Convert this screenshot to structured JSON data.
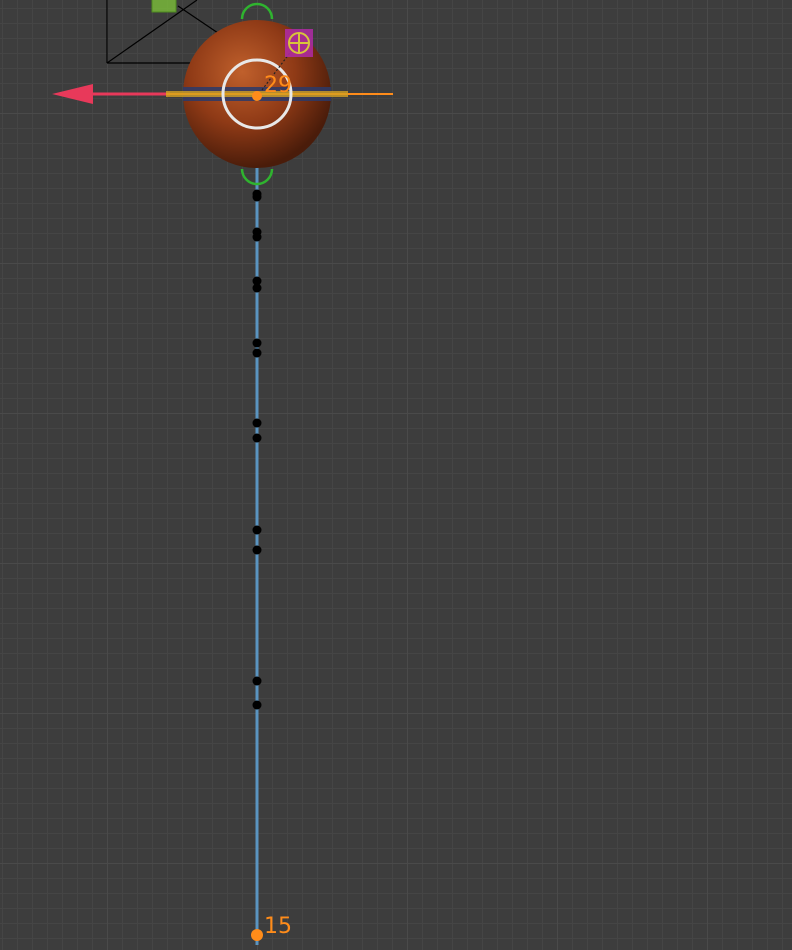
{
  "viewport": {
    "background_color": "#3d3d3d",
    "grid_major_color": "#4a4a4a",
    "grid_minor_color": "#454545"
  },
  "motion_path": {
    "path_color": "#5a94c0",
    "keyframe_point_color": "#000000",
    "current_frame_label": "29",
    "end_frame_label": "15",
    "frame_label_color": "#ff8c1a",
    "end_point_color": "#ff8c1a"
  },
  "object": {
    "name_icon": "sphere-object",
    "base_color": "#a5441c",
    "band_color": "#2a3a6a"
  },
  "gizmo": {
    "x_axis_color": "#e8395a",
    "y_axis_color": "#ff8c1a",
    "rotate_ring_color": "#2fb32f",
    "scale_circle_color": "#e8e8e8"
  },
  "camera": {
    "outline_color": "#000000",
    "indicator_color": "#7cbf3a"
  },
  "pivot": {
    "icon": "crosshair-icon",
    "box_color": "#b02aa6",
    "crosshair_color": "#d8c43a"
  }
}
